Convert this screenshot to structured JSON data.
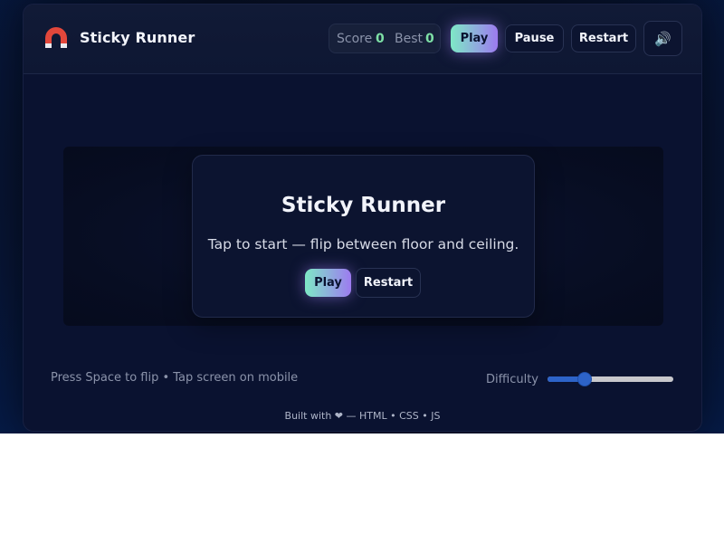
{
  "app": {
    "title": "Sticky Runner",
    "logo_icon": "magnet-icon"
  },
  "scoreboard": {
    "score_label": "Score",
    "score_value": "0",
    "best_label": "Best",
    "best_value": "0"
  },
  "toolbar": {
    "play_label": "Play",
    "pause_label": "Pause",
    "restart_label": "Restart",
    "sound_icon": "speaker-icon",
    "sound_glyph": "🔊"
  },
  "overlay": {
    "title": "Sticky Runner",
    "subtitle": "Tap to start — flip between floor and ceiling.",
    "play_label": "Play",
    "restart_label": "Restart"
  },
  "controls": {
    "hint": "Press Space to flip • Tap screen on mobile",
    "difficulty_label": "Difficulty",
    "difficulty_value": 0.27
  },
  "footer": {
    "text": "Built with ❤ — HTML • CSS • JS"
  },
  "colors": {
    "accent_gradient_start": "#7ee8c6",
    "accent_gradient_end": "#9d7bf0",
    "score_value": "#7ee0a6",
    "slider_accent": "#2d63c8",
    "background": "#0a1230"
  }
}
